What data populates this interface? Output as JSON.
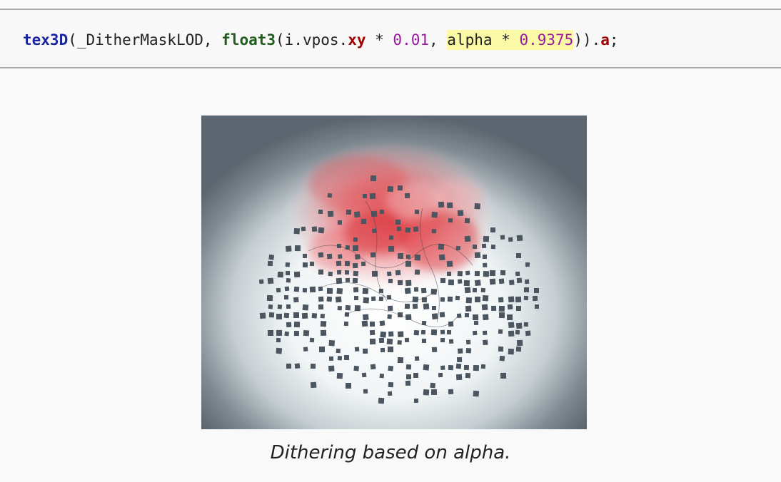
{
  "code": {
    "fn": "tex3D",
    "open_paren": "(",
    "arg1": "_DitherMaskLOD, ",
    "ctor": "float3",
    "ctor_open": "(i.vpos.",
    "swizzle": "xy",
    "mul1": " * ",
    "num1": "0.01",
    "comma": ", ",
    "hl_var": "alpha",
    "hl_mul": " * ",
    "hl_num": "0.9375",
    "close": ")).",
    "member": "a",
    "semi": ";"
  },
  "figure": {
    "colors": {
      "background_edge": "#5b6670",
      "glow_center": "#ffffff",
      "tint": "#e13a40",
      "dither_square": "#4b5660"
    }
  },
  "caption": "Dithering based on alpha."
}
